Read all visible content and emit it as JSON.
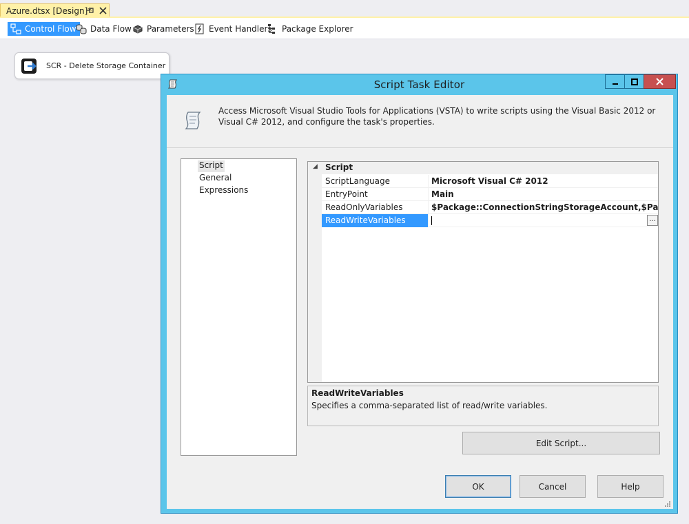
{
  "document_tab": {
    "title": "Azure.dtsx [Design]*",
    "pin_glyph": "⊣",
    "close_glyph": "✕",
    "accent": "#fff1a8"
  },
  "designer_tabs": [
    {
      "label": "Control Flow",
      "icon": "control-flow-icon",
      "active": true
    },
    {
      "label": "Data Flow",
      "icon": "data-flow-icon",
      "active": false
    },
    {
      "label": "Parameters",
      "icon": "parameters-icon",
      "active": false
    },
    {
      "label": "Event Handlers",
      "icon": "event-handlers-icon",
      "active": false
    },
    {
      "label": "Package Explorer",
      "icon": "package-explorer-icon",
      "active": false
    }
  ],
  "canvas": {
    "task": {
      "label": "SCR - Delete Storage Container",
      "icon": "script-task-icon"
    }
  },
  "dialog": {
    "title": "Script Task Editor",
    "title_bar_color": "#5bc5ea",
    "close_color": "#c75050",
    "header_text": "Access Microsoft Visual Studio Tools for Applications (VSTA) to write scripts using the Visual Basic 2012 or Visual C# 2012, and configure the task's properties.",
    "nav": {
      "items": [
        "Script",
        "General",
        "Expressions"
      ],
      "selected": "Script"
    },
    "grid": {
      "category": "Script",
      "category_toggle": "◢",
      "rows": [
        {
          "name": "ScriptLanguage",
          "value": "Microsoft Visual C# 2012"
        },
        {
          "name": "EntryPoint",
          "value": "Main"
        },
        {
          "name": "ReadOnlyVariables",
          "value": "$Package::ConnectionStringStorageAccount,$Package::Con"
        },
        {
          "name": "ReadWriteVariables",
          "value": "",
          "selected": true
        }
      ],
      "ellipsis_label": "..."
    },
    "description": {
      "title": "ReadWriteVariables",
      "text": "Specifies a comma-separated list of read/write variables."
    },
    "buttons": {
      "edit_script": "Edit Script...",
      "ok": "OK",
      "cancel": "Cancel",
      "help": "Help"
    }
  }
}
